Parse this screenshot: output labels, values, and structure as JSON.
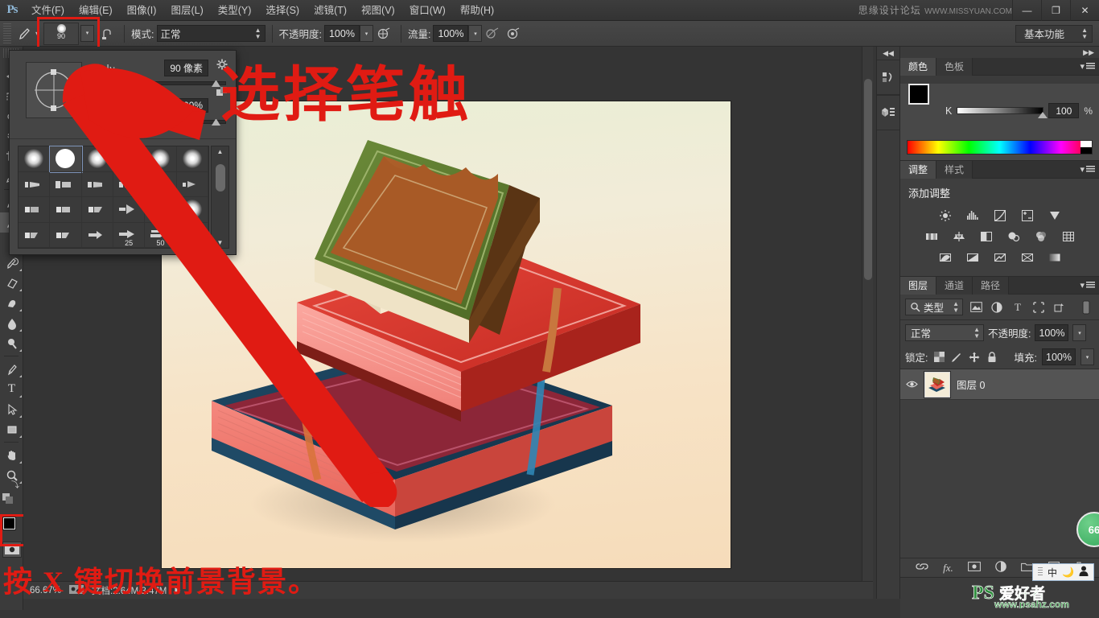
{
  "app": {
    "logo": "Ps",
    "title_watermark": "思缘设计论坛",
    "title_watermark_url": "WWW.MISSYUAN.COM"
  },
  "menubar": {
    "items": [
      {
        "label": "文件(F)",
        "name": "menu-file"
      },
      {
        "label": "编辑(E)",
        "name": "menu-edit"
      },
      {
        "label": "图像(I)",
        "name": "menu-image"
      },
      {
        "label": "图层(L)",
        "name": "menu-layer"
      },
      {
        "label": "类型(Y)",
        "name": "menu-type"
      },
      {
        "label": "选择(S)",
        "name": "menu-select"
      },
      {
        "label": "滤镜(T)",
        "name": "menu-filter"
      },
      {
        "label": "视图(V)",
        "name": "menu-view"
      },
      {
        "label": "窗口(W)",
        "name": "menu-window"
      },
      {
        "label": "帮助(H)",
        "name": "menu-help"
      }
    ],
    "window_controls": {
      "minimize": "—",
      "restore": "❐",
      "close": "✕"
    }
  },
  "options_bar": {
    "brush_size_chip": "90",
    "mode_label": "模式:",
    "mode_value": "正常",
    "opacity_label": "不透明度:",
    "opacity_value": "100%",
    "flow_label": "流量:",
    "flow_value": "100%",
    "workspace": "基本功能"
  },
  "brush_panel": {
    "size_label": "大小:",
    "size_value": "90 像素",
    "hardness_label": "硬度:",
    "hardness_value": "100%",
    "presets": [
      {
        "name": "soft-round",
        "type": "soft",
        "label": ""
      },
      {
        "name": "hard-round",
        "type": "hard",
        "label": "",
        "selected": true
      },
      {
        "name": "soft-round-2",
        "type": "soft",
        "label": ""
      },
      {
        "name": "soft-round-3",
        "type": "soft",
        "label": ""
      },
      {
        "name": "soft-round-4",
        "type": "soft",
        "label": ""
      },
      {
        "name": "soft-round-5",
        "type": "soft",
        "label": ""
      },
      {
        "name": "flat-1",
        "type": "flat",
        "label": ""
      },
      {
        "name": "flat-2",
        "type": "flat",
        "label": ""
      },
      {
        "name": "flat-3",
        "type": "flat",
        "label": ""
      },
      {
        "name": "flat-4",
        "type": "flat",
        "label": ""
      },
      {
        "name": "fan-1",
        "type": "fan",
        "label": ""
      },
      {
        "name": "fan-2",
        "type": "fan",
        "label": ""
      },
      {
        "name": "blunt-1",
        "type": "blunt",
        "label": ""
      },
      {
        "name": "blunt-2",
        "type": "blunt",
        "label": ""
      },
      {
        "name": "blunt-3",
        "type": "blunt",
        "label": ""
      },
      {
        "name": "cone-1",
        "type": "cone",
        "label": ""
      },
      {
        "name": "soft-round-6",
        "type": "soft",
        "label": ""
      },
      {
        "name": "soft-round-7",
        "type": "soft",
        "label": ""
      },
      {
        "name": "angled-1",
        "type": "blunt",
        "label": ""
      },
      {
        "name": "angled-2",
        "type": "blunt",
        "label": ""
      },
      {
        "name": "point-1",
        "type": "cone",
        "label": ""
      },
      {
        "name": "point-25",
        "type": "cone",
        "label": "25"
      },
      {
        "name": "point-50",
        "type": "cone",
        "label": "50"
      },
      {
        "name": "point-3",
        "type": "cone",
        "label": ""
      }
    ]
  },
  "toolbar": {
    "tools": [
      {
        "name": "move-tool",
        "glyph": "✥"
      },
      {
        "name": "marquee-tool",
        "glyph": "▭"
      },
      {
        "name": "lasso-tool",
        "glyph": "✧"
      },
      {
        "name": "quick-select-tool",
        "glyph": "✦"
      },
      {
        "name": "crop-tool",
        "glyph": "⌗"
      },
      {
        "name": "eyedropper-tool",
        "glyph": "✐"
      },
      {
        "name": "healing-brush-tool",
        "glyph": "✚"
      },
      {
        "name": "brush-tool",
        "glyph": "✎"
      },
      {
        "name": "clone-stamp-tool",
        "glyph": "⎔"
      },
      {
        "name": "history-brush-tool",
        "glyph": "↺"
      },
      {
        "name": "eraser-tool",
        "glyph": "▱"
      },
      {
        "name": "gradient-tool",
        "glyph": "▤"
      },
      {
        "name": "blur-tool",
        "glyph": "💧"
      },
      {
        "name": "dodge-tool",
        "glyph": "⬤"
      },
      {
        "name": "pen-tool",
        "glyph": "✒"
      },
      {
        "name": "type-tool",
        "glyph": "T"
      },
      {
        "name": "path-selection-tool",
        "glyph": "➤"
      },
      {
        "name": "shape-tool",
        "glyph": "▢"
      },
      {
        "name": "hand-tool",
        "glyph": "✋"
      },
      {
        "name": "zoom-tool",
        "glyph": "🔍"
      }
    ],
    "foreground_color": "#000000",
    "background_color": "#ffffff"
  },
  "status_bar": {
    "zoom": "66.67%",
    "doc_label": "文档:2.64M/3.47M"
  },
  "color_panel": {
    "tabs": [
      {
        "label": "颜色",
        "active": true
      },
      {
        "label": "色板",
        "active": false
      }
    ],
    "channel_label": "K",
    "channel_value": "100",
    "unit": "%",
    "foreground": "#000000",
    "background": "#ffffff"
  },
  "adjustments_panel": {
    "tabs": [
      {
        "label": "调整",
        "active": true
      },
      {
        "label": "样式",
        "active": false
      }
    ],
    "title": "添加调整",
    "row1": [
      "brightness-contrast-icon",
      "levels-icon",
      "curves-icon",
      "exposure-icon",
      "vibrance-icon"
    ],
    "row2": [
      "hue-saturation-icon",
      "color-balance-icon",
      "black-white-icon",
      "photo-filter-icon",
      "channel-mixer-icon",
      "color-lookup-icon"
    ],
    "row3": [
      "invert-icon",
      "posterize-icon",
      "threshold-icon",
      "gradient-map-icon",
      "selective-color-icon"
    ]
  },
  "layers_panel": {
    "tabs": [
      {
        "label": "图层",
        "active": true
      },
      {
        "label": "通道",
        "active": false
      },
      {
        "label": "路径",
        "active": false
      }
    ],
    "filter_kind": "类型",
    "blend_mode": "正常",
    "opacity_label": "不透明度:",
    "opacity_value": "100%",
    "lock_label": "锁定:",
    "fill_label": "填充:",
    "fill_value": "100%",
    "layers": [
      {
        "name": "图层 0",
        "visible": true
      }
    ],
    "bottom_icons": [
      "link-icon",
      "fx-icon",
      "mask-icon",
      "adjustment-icon",
      "group-icon",
      "new-layer-icon",
      "delete-icon"
    ]
  },
  "annotations": {
    "arrow_note": "选择笔触",
    "bottom_note": "按 X 键切换前景背景。",
    "accent_color": "#e01b13"
  },
  "watermarks": {
    "bottom_brand": "PS爱好者",
    "bottom_url": "www.psahz.com",
    "badge": "66"
  },
  "ime_bar": {
    "lang": "中",
    "mode_icon": "moon-icon",
    "user_icon": "person-icon"
  }
}
